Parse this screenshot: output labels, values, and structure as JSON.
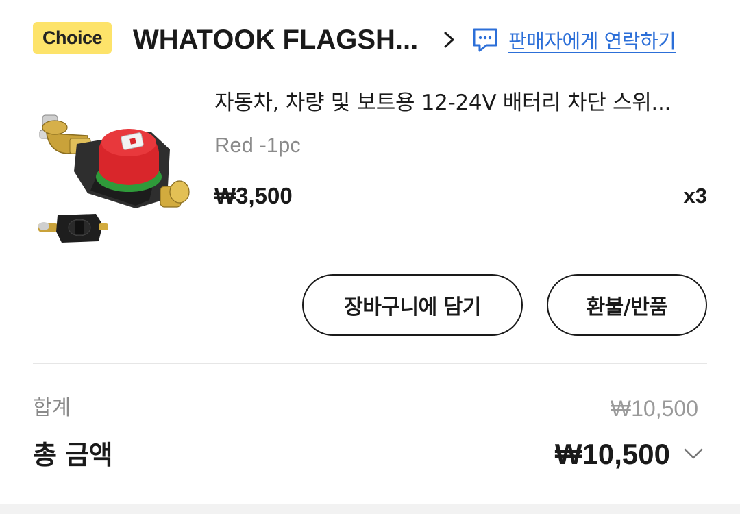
{
  "store": {
    "badge": "Choice",
    "name": "WHATOOK FLAGSH...",
    "contact_label": "판매자에게 연락하기",
    "icons": {
      "store_arrow": "chevron-right-icon",
      "contact": "chat-bubble-icon"
    }
  },
  "product": {
    "title": "자동차, 차량 및 보트용 12-24V 배터리 차단 스위...",
    "variant": "Red -1pc",
    "price": "₩3,500",
    "quantity": "x3",
    "image": "battery-disconnect-switch-photo"
  },
  "actions": {
    "add_to_cart": "장바구니에 담기",
    "refund_return": "환불/반품"
  },
  "summary": {
    "subtotal_label": "합계",
    "subtotal_value": "₩10,500",
    "total_label": "총 금액",
    "total_value": "₩10,500",
    "expand_icon": "chevron-down-icon"
  },
  "colors": {
    "badge_bg": "#fde36a",
    "link": "#2c6fd8",
    "text": "#1a1a1a",
    "muted": "#8a8a8a"
  }
}
